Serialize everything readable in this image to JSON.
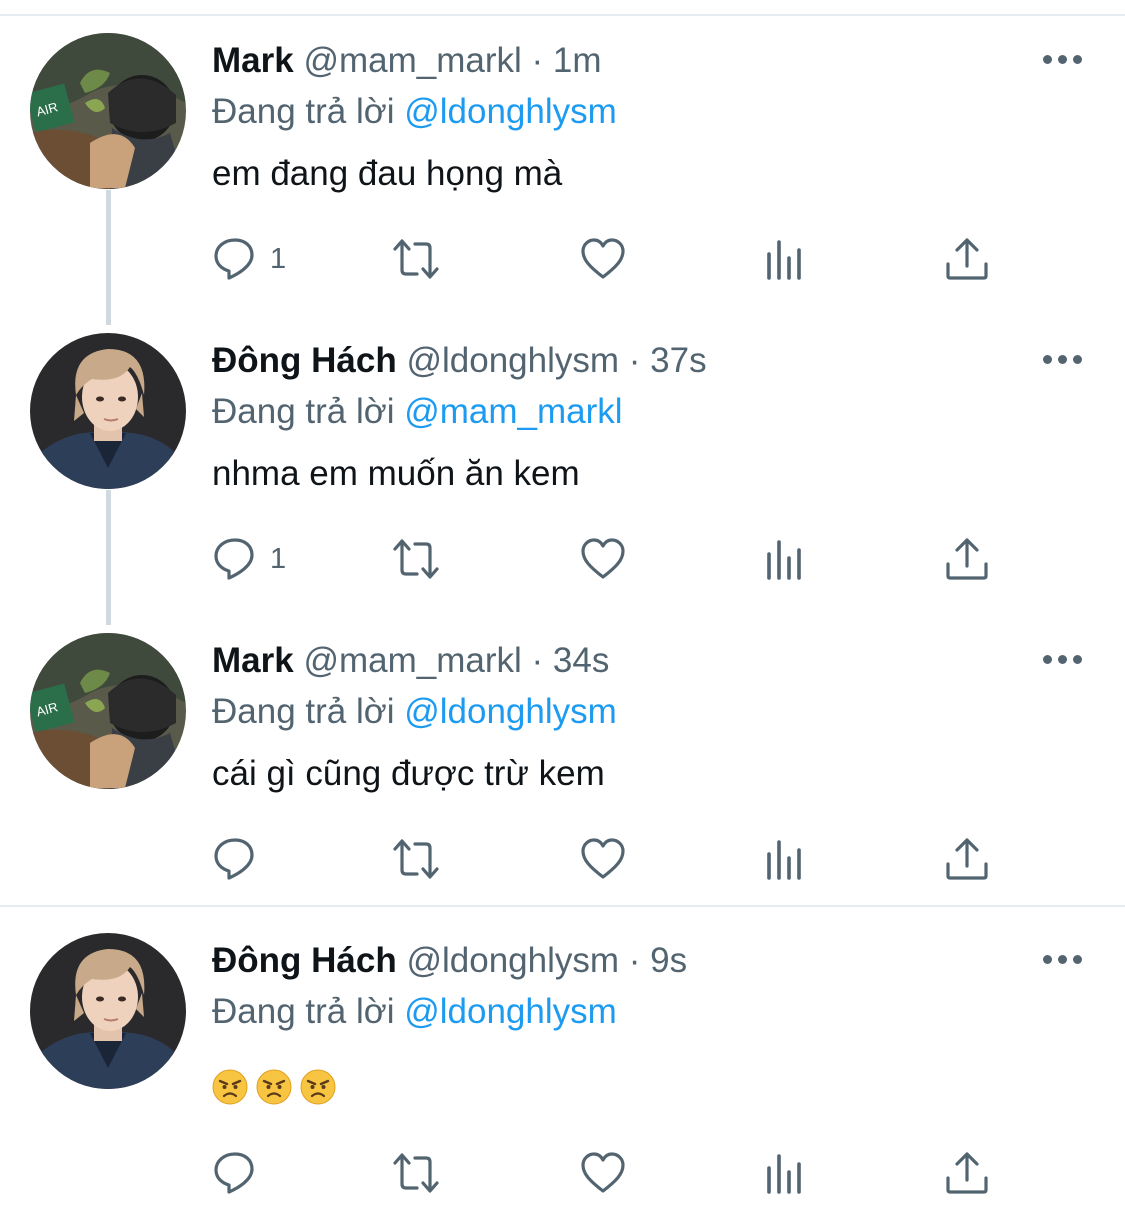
{
  "reply_prefix": "Đang trả lời",
  "colors": {
    "text": "#0f1419",
    "secondary": "#536471",
    "link": "#1d9bf0",
    "divider": "#e6ecf0",
    "thread_line": "#cfd9de"
  },
  "icons": [
    "reply-icon",
    "retweet-icon",
    "like-icon",
    "analytics-icon",
    "share-icon",
    "more-icon"
  ],
  "tweets": [
    {
      "name": "Mark",
      "handle": "@mam_markl",
      "dot": "·",
      "time": "1m",
      "replying_to": "@ldonghlysm",
      "text": "em đang đau họng mà",
      "reply_count": "1"
    },
    {
      "name": "Đông Hách",
      "handle": "@ldonghlysm",
      "dot": "·",
      "time": "37s",
      "replying_to": "@mam_markl",
      "text": "nhma em muốn ăn kem",
      "reply_count": "1"
    },
    {
      "name": "Mark",
      "handle": "@mam_markl",
      "dot": "·",
      "time": "34s",
      "replying_to": "@ldonghlysm",
      "text": "cái gì cũng được trừ kem",
      "reply_count": ""
    },
    {
      "name": "Đông Hách",
      "handle": "@ldonghlysm",
      "dot": "·",
      "time": "9s",
      "replying_to": "@ldonghlysm",
      "emojis": [
        "angry-face",
        "angry-face",
        "angry-face"
      ],
      "reply_count": ""
    }
  ]
}
